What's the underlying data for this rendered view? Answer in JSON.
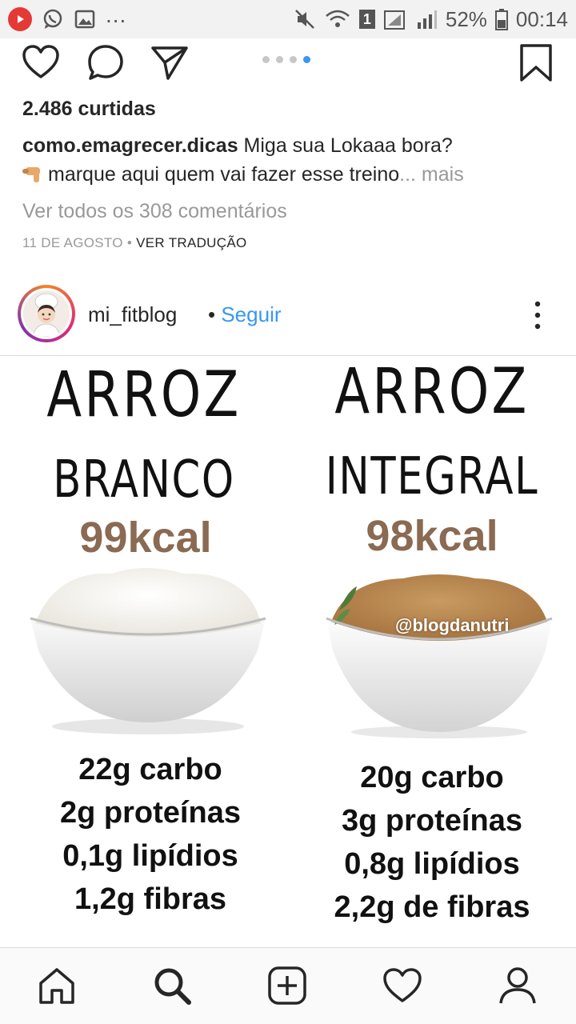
{
  "status_bar": {
    "dots": "...",
    "sim_number": "1",
    "battery": "52%",
    "time": "00:14"
  },
  "carousel": {
    "count": 4,
    "active_index": 3
  },
  "post": {
    "likes": "2.486 curtidas",
    "author": "como.emagrecer.dicas",
    "caption_line1": "Miga sua Lokaaa bora?",
    "caption_line2": "marque aqui quem vai fazer esse treino",
    "caption_ellipsis": "...",
    "more_label": "mais",
    "view_comments": "Ver todos os 308 comentários",
    "date": "11 DE AGOSTO",
    "separator": "•",
    "translate": "VER TRADUÇÃO"
  },
  "next_post": {
    "username": "mi_fitblog",
    "separator": "•",
    "follow_label": "Seguir"
  },
  "image": {
    "left": {
      "title": "ARROZ",
      "variety": "BRANCO",
      "kcal": "99kcal",
      "nutrients": [
        "22g carbo",
        "2g proteínas",
        "0,1g lipídios",
        "1,2g fibras"
      ]
    },
    "right": {
      "title": "ARROZ",
      "variety": "INTEGRAL",
      "kcal": "98kcal",
      "watermark": "@blogdanutri",
      "nutrients": [
        "20g carbo",
        "3g proteínas",
        "0,8g lipídios",
        "2,2g de fibras"
      ]
    }
  },
  "icons": {
    "status": [
      "youtube-icon",
      "whatsapp-icon",
      "gallery-icon",
      "mute-icon",
      "wifi-icon",
      "signal-icon",
      "battery-icon"
    ],
    "actions": [
      "heart-icon",
      "comment-icon",
      "share-icon",
      "bookmark-icon"
    ],
    "nav": [
      "home-icon",
      "search-icon",
      "add-icon",
      "activity-heart-icon",
      "profile-icon"
    ]
  },
  "colors": {
    "link_blue": "#3897f0",
    "muted_text": "#999999",
    "kcal_brown": "#8a6a52",
    "youtube_red": "#e53935"
  }
}
